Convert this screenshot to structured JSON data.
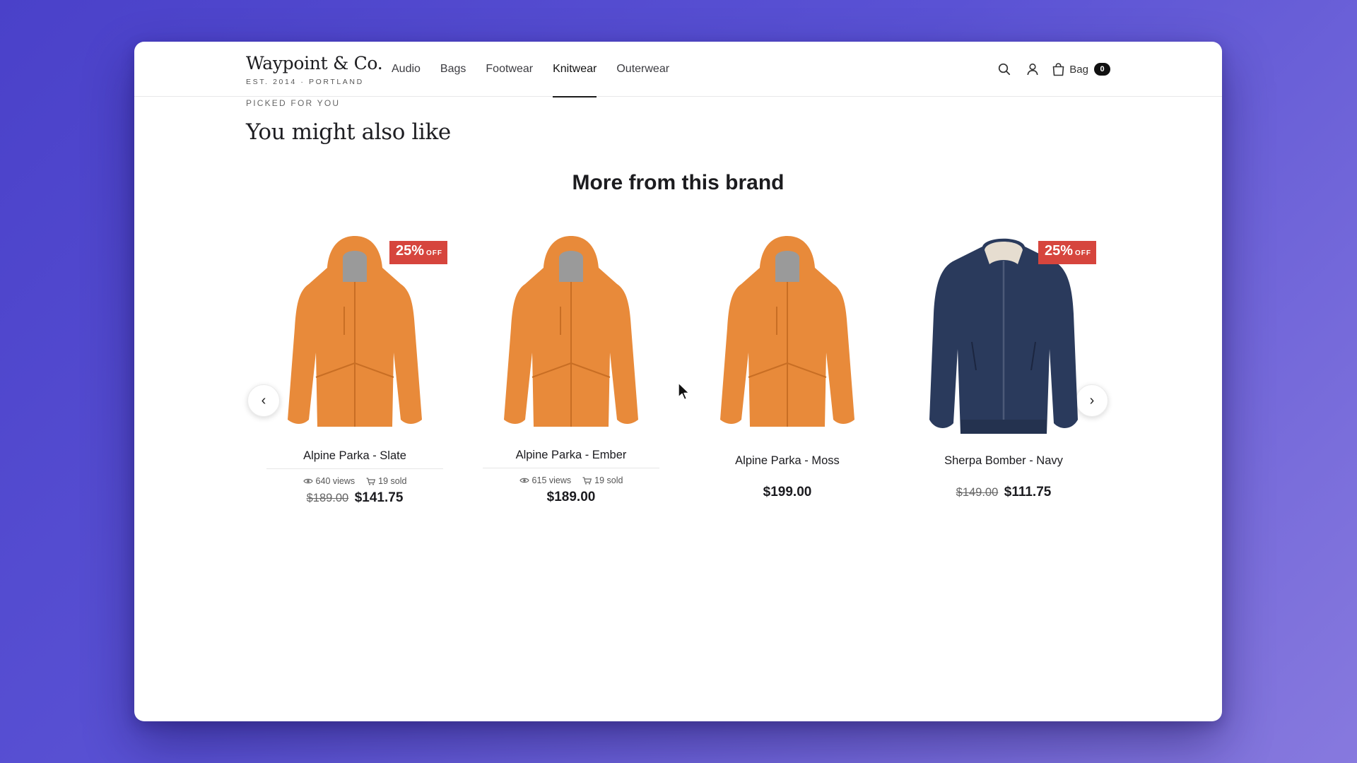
{
  "brand": {
    "name": "Waypoint & Co.",
    "tagline": "EST. 2014 · PORTLAND"
  },
  "nav": [
    {
      "label": "Audio",
      "active": false
    },
    {
      "label": "Bags",
      "active": false
    },
    {
      "label": "Footwear",
      "active": false
    },
    {
      "label": "Knitwear",
      "active": true
    },
    {
      "label": "Outerwear",
      "active": false
    }
  ],
  "tools": {
    "search_icon": "search-icon",
    "account_icon": "user-icon",
    "bag_icon": "shopping-bag-icon",
    "bag_label": "Bag",
    "bag_count": "0"
  },
  "section": {
    "eyebrow": "PICKED FOR YOU",
    "title": "You might also like"
  },
  "carousel": {
    "title": "More from this brand",
    "prev": "‹",
    "next": "›"
  },
  "products": [
    {
      "name": "Alpine Parka - Slate",
      "badge_pct": "25%",
      "badge_off": "OFF",
      "views": "640 views",
      "sold": "19 sold",
      "old_price": "$189.00",
      "price": "$141.75",
      "color": "#e88a3a"
    },
    {
      "name": "Alpine Parka - Ember",
      "badge_pct": "",
      "badge_off": "",
      "views": "615 views",
      "sold": "19 sold",
      "old_price": "",
      "price": "$189.00",
      "color": "#e88a3a"
    },
    {
      "name": "Alpine Parka - Moss",
      "badge_pct": "",
      "badge_off": "",
      "views": "",
      "sold": "",
      "old_price": "",
      "price": "$199.00",
      "color": "#e88a3a"
    },
    {
      "name": "Sherpa Bomber - Navy",
      "badge_pct": "25%",
      "badge_off": "OFF",
      "views": "",
      "sold": "",
      "old_price": "$149.00",
      "price": "$111.75",
      "color": "#2a3a5c"
    }
  ]
}
